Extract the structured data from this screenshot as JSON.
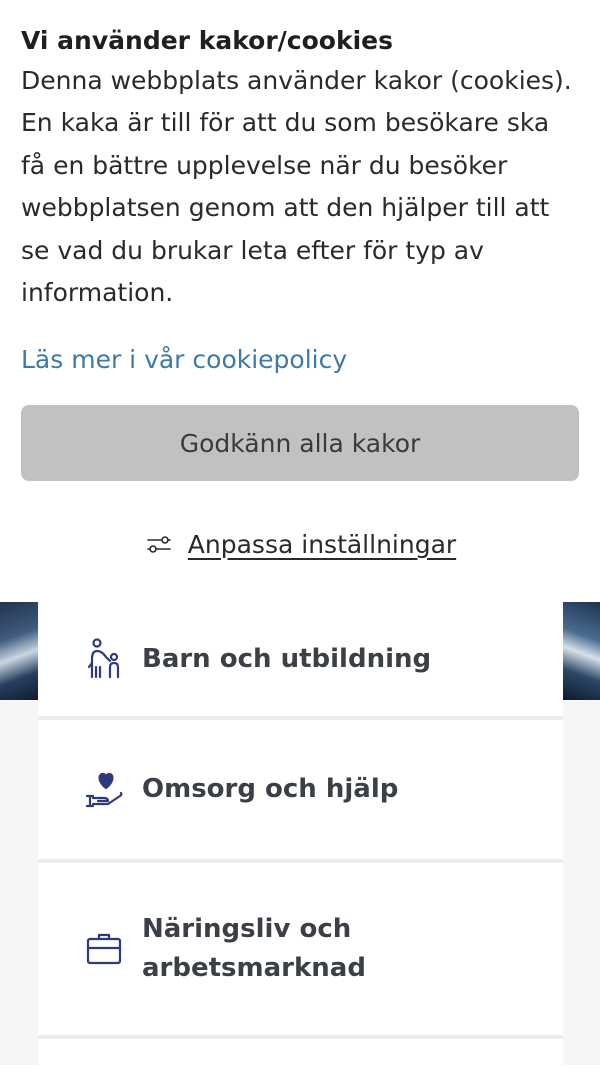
{
  "cookie_banner": {
    "title": "Vi använder kakor/cookies",
    "body": "Denna webbplats använder kakor (cookies). En kaka är till för att du som besökare ska få en bättre upplevelse när du besöker webbplatsen genom att den hjälper till att se vad du brukar leta efter för typ av information.",
    "policy_link": "Läs mer i vår cookiepolicy",
    "accept_button": "Godkänn alla kakor",
    "customize_link": "Anpassa inställningar",
    "customize_icon": "sliders-icon"
  },
  "categories": [
    {
      "label": "Barn och utbildning",
      "icon": "parent-child-icon"
    },
    {
      "label": "Omsorg och hjälp",
      "icon": "heart-hand-icon"
    },
    {
      "label": "Näringsliv och arbetsmarknad",
      "icon": "briefcase-icon"
    }
  ],
  "colors": {
    "link": "#3d7aa8",
    "icon": "#2f3a7a",
    "accept_bg": "#c1c1c1",
    "heart": "#2f3a7a"
  }
}
